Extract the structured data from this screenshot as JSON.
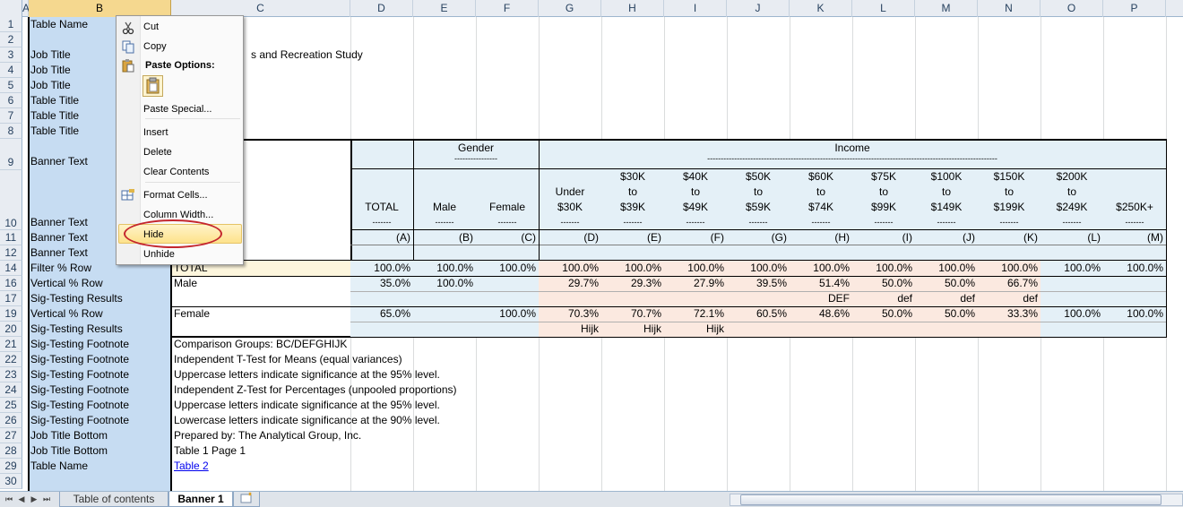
{
  "columns": [
    "A",
    "B",
    "C",
    "D",
    "E",
    "F",
    "G",
    "H",
    "I",
    "J",
    "K",
    "L",
    "M",
    "N",
    "O",
    "P"
  ],
  "rows": [
    "1",
    "2",
    "3",
    "4",
    "5",
    "6",
    "7",
    "8",
    "9",
    "10",
    "11",
    "12",
    "14",
    "16",
    "17",
    "19",
    "20",
    "21",
    "22",
    "23",
    "24",
    "25",
    "26",
    "27",
    "28",
    "29",
    "30"
  ],
  "colB_labels": {
    "r1": "Table Name",
    "r3": "Job Title",
    "r4": "Job Title",
    "r5": "Job Title",
    "r6": "Table Title",
    "r7": "Table Title",
    "r8": "Table Title",
    "r9": "Banner Text",
    "r10": "Banner Text",
    "r11": "Banner Text",
    "r12": "Banner Text",
    "r14": "Filter % Row",
    "r16": "Vertical % Row",
    "r17": "Sig-Testing Results",
    "r19": "Vertical % Row",
    "r20": "Sig-Testing Results",
    "r21": "Sig-Testing Footnote",
    "r22": "Sig-Testing Footnote",
    "r23": "Sig-Testing Footnote",
    "r24": "Sig-Testing Footnote",
    "r25": "Sig-Testing Footnote",
    "r26": "Sig-Testing Footnote",
    "r27": "Job Title Bottom",
    "r28": "Job Title Bottom",
    "r29": "Table Name"
  },
  "row3_text": "s and Recreation Study",
  "banner": {
    "gender": "Gender",
    "income": "Income",
    "dashes_short": "----------------",
    "dashes_long": "------------------------------------------------------------------------------------------------------------",
    "col_dash": "-------",
    "headers": [
      {
        "l1": "",
        "l2": "",
        "l3": "TOTAL",
        "letter": "(A)"
      },
      {
        "l1": "",
        "l2": "",
        "l3": "Male",
        "letter": "(B)"
      },
      {
        "l1": "",
        "l2": "",
        "l3": "Female",
        "letter": "(C)"
      },
      {
        "l1": "",
        "l2": "Under",
        "l3": "$30K",
        "letter": "(D)"
      },
      {
        "l1": "$30K",
        "l2": "to",
        "l3": "$39K",
        "letter": "(E)"
      },
      {
        "l1": "$40K",
        "l2": "to",
        "l3": "$49K",
        "letter": "(F)"
      },
      {
        "l1": "$50K",
        "l2": "to",
        "l3": "$59K",
        "letter": "(G)"
      },
      {
        "l1": "$60K",
        "l2": "to",
        "l3": "$74K",
        "letter": "(H)"
      },
      {
        "l1": "$75K",
        "l2": "to",
        "l3": "$99K",
        "letter": "(I)"
      },
      {
        "l1": "$100K",
        "l2": "to",
        "l3": "$149K",
        "letter": "(J)"
      },
      {
        "l1": "$150K",
        "l2": "to",
        "l3": "$199K",
        "letter": "(K)"
      },
      {
        "l1": "$200K",
        "l2": "to",
        "l3": "$249K",
        "letter": "(L)"
      },
      {
        "l1": "",
        "l2": "",
        "l3": "$250K+",
        "letter": "(M)"
      }
    ]
  },
  "data_rows": {
    "total_label": "TOTAL",
    "total": [
      "100.0%",
      "100.0%",
      "100.0%",
      "100.0%",
      "100.0%",
      "100.0%",
      "100.0%",
      "100.0%",
      "100.0%",
      "100.0%",
      "100.0%",
      "100.0%",
      "100.0%"
    ],
    "male_label": "Male",
    "male": [
      "35.0%",
      "100.0%",
      "",
      "29.7%",
      "29.3%",
      "27.9%",
      "39.5%",
      "51.4%",
      "50.0%",
      "50.0%",
      "66.7%",
      "",
      ""
    ],
    "male_sig": [
      "",
      "",
      "",
      "",
      "",
      "",
      "",
      "DEF",
      "def",
      "def",
      "def",
      "",
      ""
    ],
    "female_label": "Female",
    "female": [
      "65.0%",
      "",
      "100.0%",
      "70.3%",
      "70.7%",
      "72.1%",
      "60.5%",
      "48.6%",
      "50.0%",
      "50.0%",
      "33.3%",
      "100.0%",
      "100.0%"
    ],
    "female_sig": [
      "",
      "",
      "",
      "Hijk",
      "Hijk",
      "Hijk",
      "",
      "",
      "",
      "",
      "",
      "",
      ""
    ]
  },
  "footnotes": {
    "r21": "Comparison Groups: BC/DEFGHIJK",
    "r22": "Independent T-Test for Means (equal variances)",
    "r23": "Uppercase letters indicate significance at the 95% level.",
    "r24": "Independent Z-Test for Percentages (unpooled proportions)",
    "r25": "Uppercase letters indicate significance at the 95% level.",
    "r26": "Lowercase letters indicate significance at the 90% level.",
    "r27": "Prepared by: The Analytical Group, Inc.",
    "r28": "Table 1 Page 1",
    "r29": "Table 2"
  },
  "context_menu": {
    "cut": "Cut",
    "copy": "Copy",
    "paste_options": "Paste Options:",
    "paste_special": "Paste Special...",
    "insert": "Insert",
    "delete": "Delete",
    "clear_contents": "Clear Contents",
    "format_cells": "Format Cells...",
    "column_width": "Column Width...",
    "hide": "Hide",
    "unhide": "Unhide"
  },
  "tabs": {
    "toc": "Table of contents",
    "banner1": "Banner 1"
  }
}
